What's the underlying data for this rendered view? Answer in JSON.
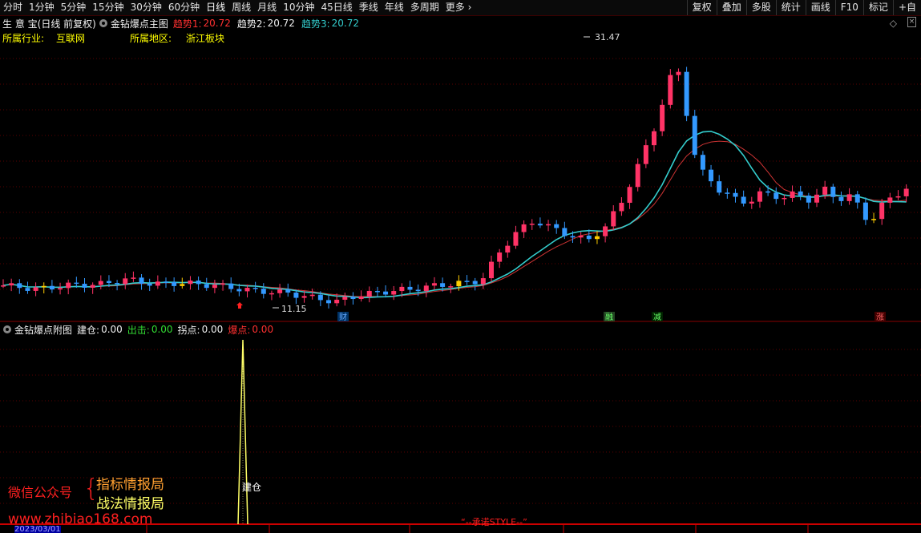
{
  "toolbar": {
    "periods": [
      "分时",
      "1分钟",
      "5分钟",
      "15分钟",
      "30分钟",
      "60分钟",
      "日线",
      "周线",
      "月线",
      "10分钟",
      "45日线",
      "季线",
      "年线",
      "多周期"
    ],
    "active_period": "日线",
    "more_label": "更多",
    "right_buttons": [
      "复权",
      "叠加",
      "多股",
      "统计",
      "画线",
      "F10",
      "标记",
      "+自"
    ]
  },
  "main_header": {
    "stock_name": "生 意 宝",
    "mode": "(日线 前复权)",
    "indicator": "金钻爆点主图",
    "trend1_label": "趋势1:",
    "trend1_value": "20.72",
    "trend2_label": "趋势2:",
    "trend2_value": "20.72",
    "trend3_label": "趋势3:",
    "trend3_value": "20.72"
  },
  "info": {
    "industry_label": "所属行业:",
    "industry_value": "互联网",
    "region_label": "所属地区:",
    "region_value": "浙江板块"
  },
  "chart_marks": {
    "high_label": "31.47",
    "low_label": "11.15",
    "events": [
      "财",
      "融",
      "减",
      "涨"
    ]
  },
  "sub_header": {
    "indicator": "金钻爆点附图",
    "build_label": "建仓:",
    "build_value": "0.00",
    "exit_label": "出击:",
    "exit_value": "0.00",
    "turn_label": "拐点:",
    "turn_value": "0.00",
    "burst_label": "爆点:",
    "burst_value": "0.00",
    "signal_label": "建仓"
  },
  "watermark": {
    "wechat": "微信公众号",
    "brace": "{",
    "line1": "指标情报局",
    "line2": "战法情报局",
    "url": "www.zhibiao168.com",
    "style": "“--承诺STYLE--”",
    "date": "2023/03/01"
  },
  "colors": {
    "up": "#ff3366",
    "down": "#3399ff",
    "ma": "#33cccc",
    "ma2": "#cc3333",
    "yellow": "#ffff66",
    "grid": "#5a0000"
  },
  "chart_data": {
    "type": "candlestick",
    "high": 31.47,
    "low": 11.15,
    "last_close": 20.72,
    "signal_peak": "建仓"
  }
}
